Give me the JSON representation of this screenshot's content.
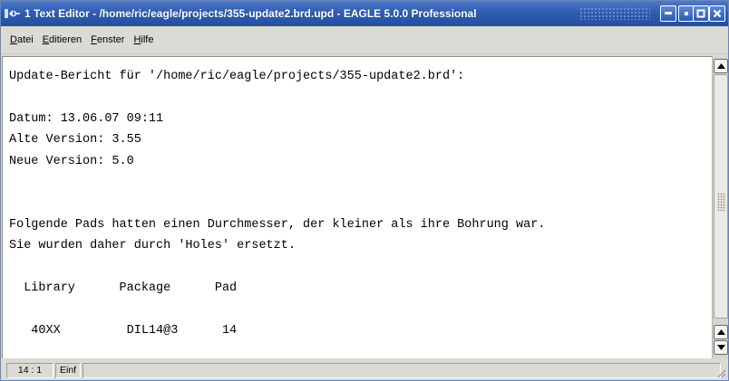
{
  "window": {
    "title": "1 Text Editor - /home/ric/eagle/projects/355-update2.brd.upd - EAGLE 5.0.0 Professional"
  },
  "menu": {
    "datei": "Datei",
    "edit": "Editieren",
    "fenster": "Fenster",
    "hilfe": "Hilfe"
  },
  "editor": {
    "content": "Update-Bericht für '/home/ric/eagle/projects/355-update2.brd':\n\nDatum: 13.06.07 09:11\nAlte Version: 3.55\nNeue Version: 5.0\n\n\nFolgende Pads hatten einen Durchmesser, der kleiner als ihre Bohrung war.\nSie wurden daher durch 'Holes' ersetzt.\n\n  Library      Package      Pad\n\n   40XX         DIL14@3      14"
  },
  "status": {
    "position": "14 : 1",
    "mode": "Einf"
  },
  "colors": {
    "titlebar": "#2f5db2",
    "window_bg": "#dcdad5",
    "editor_bg": "#ffffff"
  },
  "icons": [
    "app-icon",
    "minimize-icon",
    "restore-icon",
    "maximize-icon",
    "close-icon",
    "scroll-up-arrow-icon",
    "scroll-down-arrow-icon"
  ]
}
